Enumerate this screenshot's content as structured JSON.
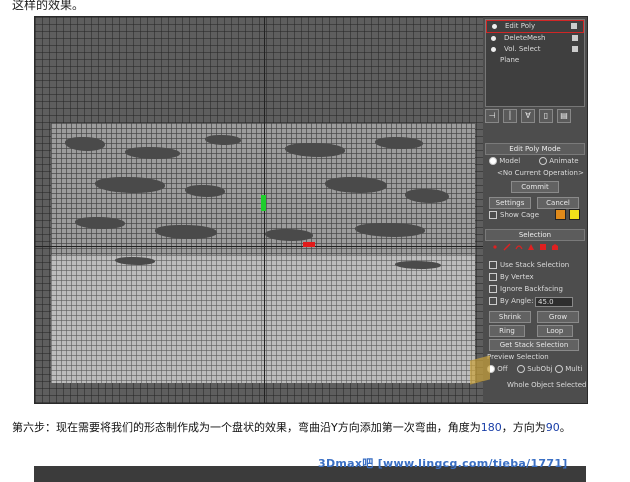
{
  "top_text": "这样的效果。",
  "viewport": {},
  "panel": {
    "stack_items": [
      {
        "label": "Edit Poly",
        "selected": true,
        "bulb": true,
        "box": true
      },
      {
        "label": "DeleteMesh",
        "selected": false,
        "bulb": true,
        "box": true
      },
      {
        "label": "Vol. Select",
        "selected": false,
        "bulb": true,
        "box": true
      },
      {
        "label": "Plane",
        "selected": false,
        "bulb": false,
        "box": false
      }
    ],
    "edit_poly_mode": {
      "header": "Edit Poly Mode",
      "model_label": "Model",
      "animate_label": "Animate",
      "current_op": "<No Current Operation>",
      "commit": "Commit",
      "settings": "Settings",
      "cancel": "Cancel",
      "show_cage": "Show Cage",
      "cage_colors": [
        "#e08a1a",
        "#f2e21a"
      ]
    },
    "selection": {
      "header": "Selection",
      "use_stack_selection": "Use Stack Selection",
      "by_vertex": "By Vertex",
      "ignore_backfacing": "Ignore Backfacing",
      "by_angle": "By Angle:",
      "angle_value": "45.0",
      "shrink": "Shrink",
      "grow": "Grow",
      "ring": "Ring",
      "loop": "Loop",
      "get_stack_selection": "Get Stack Selection",
      "preview_selection": "Preview Selection",
      "off": "Off",
      "subobj": "SubObj",
      "multi": "Multi",
      "whole_object_selected": "Whole Object Selected",
      "icon_color": "#e02020"
    }
  },
  "caption": {
    "prefix": "第六步：现在需要将我们的形态制作成为一个盘状的效果，弯曲沿Y方向添加第一次弯曲，角度为",
    "angle": "180",
    "middle": "，方向为",
    "direction": "90",
    "suffix": "。"
  },
  "watermark": "3Dmax吧 [www.lingcg.com/tieba/1771]"
}
